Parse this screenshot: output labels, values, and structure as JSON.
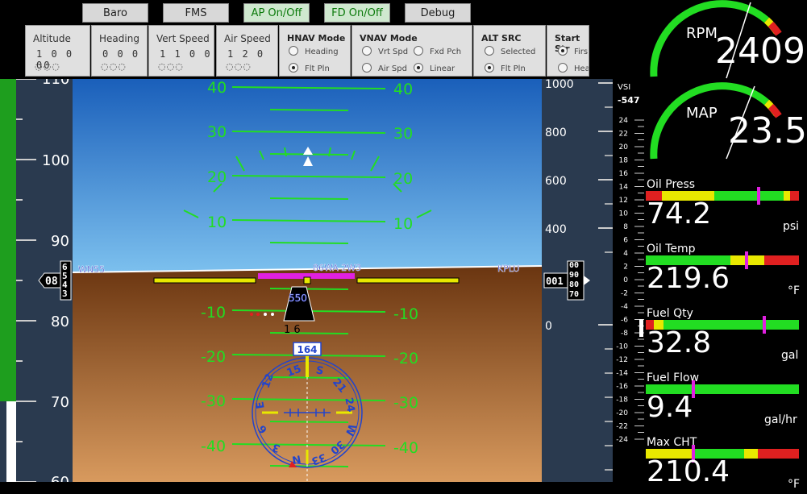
{
  "top_buttons": {
    "baro": "Baro",
    "fms": "FMS",
    "ap": "AP On/Off",
    "fd": "FD On/Off",
    "debug": "Debug"
  },
  "panel": {
    "altitude": {
      "title": "Altitude",
      "digits": "1 0 0 00",
      "knobs": "◌◌◌"
    },
    "heading": {
      "title": "Heading",
      "digits": "0 0 0",
      "knobs": "◌◌◌"
    },
    "vert_speed": {
      "title": "Vert Speed",
      "digits": "1 1 0 0",
      "knobs": "◌◌◌"
    },
    "air_speed": {
      "title": "Air Speed",
      "digits": "1 2 0",
      "knobs": "◌◌◌"
    },
    "hnav": {
      "title": "HNAV Mode",
      "opt1": "Heading",
      "opt2": "Flt Pln"
    },
    "vnav": {
      "title": "VNAV Mode",
      "opt1": "Vrt Spd",
      "opt2": "Fxd Pch",
      "opt3": "Air Spd",
      "opt4": "Linear"
    },
    "alt_src": {
      "title": "ALT SRC",
      "opt1": "Selected",
      "opt2": "Flt Pln"
    },
    "start": {
      "title": "Start Str",
      "opt1": "Firs",
      "opt2": "Hea"
    }
  },
  "pfd": {
    "pitch_labels": [
      "40",
      "30",
      "20",
      "10",
      "-10",
      "-20",
      "-30",
      "-40"
    ],
    "wp_left": "WN55",
    "wp_center": "86WA 2W3",
    "wp_right": "KPLU",
    "speed_box": "550",
    "alt_text": "1 6",
    "heading_box": "164",
    "speed_ticks": [
      "110",
      "100",
      "90",
      "80",
      "70",
      "60"
    ],
    "speed_readout": "08",
    "speed_roll": [
      "6",
      "5",
      "4",
      "3"
    ],
    "alt_ticks": [
      "1000",
      "800",
      "600",
      "400",
      "0"
    ],
    "alt_readout": "001",
    "alt_roll": [
      "00",
      "90",
      "80",
      "70"
    ],
    "vsi_label": "VSI",
    "vsi_value": "-547",
    "vsi_ticks": [
      "24",
      "22",
      "20",
      "18",
      "16",
      "14",
      "12",
      "10",
      "8",
      "6",
      "4",
      "2",
      "0",
      "-2",
      "-4",
      "-6",
      "-8",
      "-10",
      "-12",
      "-14",
      "-16",
      "-18",
      "-20",
      "-22",
      "-24"
    ],
    "compass": [
      "N",
      "3",
      "6",
      "E",
      "12",
      "15",
      "S",
      "21",
      "24",
      "W",
      "30",
      "33"
    ]
  },
  "gauges": {
    "rpm": {
      "label": "RPM",
      "value": "2409"
    },
    "map": {
      "label": "MAP",
      "value": "23.5"
    },
    "oil_press": {
      "label": "Oil Press",
      "value": "74.2",
      "unit": "psi"
    },
    "oil_temp": {
      "label": "Oil Temp",
      "value": "219.6",
      "unit": "°F"
    },
    "fuel_qty": {
      "label": "Fuel Qty",
      "value": "32.8",
      "unit": "gal"
    },
    "fuel_flow": {
      "label": "Fuel Flow",
      "value": "9.4",
      "unit": "gal/hr"
    },
    "max_cht": {
      "label": "Max CHT",
      "value": "210.4",
      "unit": "°F"
    }
  },
  "colors": {
    "sky": "#1f6fc9",
    "ground": "#8a4a1a",
    "pitch": "#22dd22",
    "magenta": "#e020e0",
    "yellow": "#e8e800",
    "compass": "#2244cc"
  }
}
